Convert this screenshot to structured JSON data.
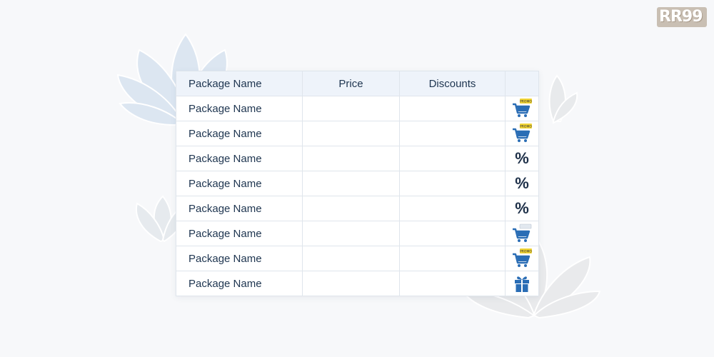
{
  "brand": {
    "logo_text": "RR99"
  },
  "table": {
    "headers": [
      "Package Name",
      "Price",
      "Discounts",
      ""
    ],
    "rows": [
      {
        "name": "Package Name",
        "price": "",
        "discount": "",
        "icon": "cart-promo-icon"
      },
      {
        "name": "Package Name",
        "price": "",
        "discount": "",
        "icon": "cart-promo-icon"
      },
      {
        "name": "Package Name",
        "price": "",
        "discount": "",
        "icon": "percent-icon"
      },
      {
        "name": "Package Name",
        "price": "",
        "discount": "",
        "icon": "percent-icon"
      },
      {
        "name": "Package Name",
        "price": "",
        "discount": "",
        "icon": "percent-icon"
      },
      {
        "name": "Package Name",
        "price": "",
        "discount": "",
        "icon": "cart-tag-icon"
      },
      {
        "name": "Package Name",
        "price": "",
        "discount": "",
        "icon": "cart-promo-icon"
      },
      {
        "name": "Package Name",
        "price": "",
        "discount": "",
        "icon": "gift-icon"
      }
    ]
  },
  "icon_labels": {
    "promo": "PROMO"
  },
  "colors": {
    "background": "#f7f8fa",
    "header_bg": "#eef3fa",
    "border": "#dfe5ec",
    "text": "#1e3550",
    "icon_blue": "#2a6db5",
    "promo_yellow": "#f2d534"
  }
}
